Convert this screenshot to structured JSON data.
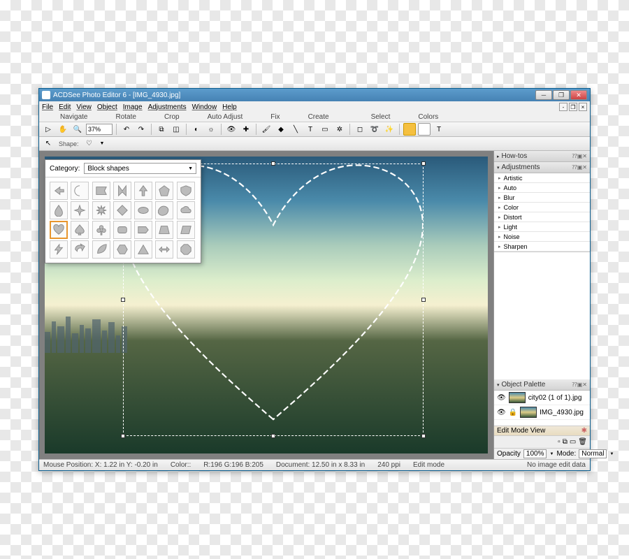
{
  "titlebar": {
    "app": "ACDSee Photo Editor 6",
    "doc": "[IMG_4930.jpg]"
  },
  "menus": [
    "File",
    "Edit",
    "View",
    "Object",
    "Image",
    "Adjustments",
    "Window",
    "Help"
  ],
  "toolgroups": {
    "navigate": "Navigate",
    "rotate": "Rotate",
    "crop": "Crop",
    "autoadj": "Auto Adjust",
    "fix": "Fix",
    "create": "Create",
    "select": "Select",
    "colors": "Colors"
  },
  "zoom": "37%",
  "shapebar": {
    "label": "Shape:"
  },
  "shape_popup": {
    "category_label": "Category:",
    "category_value": "Block shapes"
  },
  "panels": {
    "howtos": "How-tos",
    "adjustments": "Adjustments",
    "adjust_items": [
      "Artistic",
      "Auto",
      "Blur",
      "Color",
      "Distort",
      "Light",
      "Noise",
      "Sharpen"
    ],
    "object_palette": "Object Palette",
    "objects": [
      {
        "name": "city02 (1 of 1).jpg"
      },
      {
        "name": "IMG_4930.jpg"
      }
    ],
    "edit_mode": "Edit Mode View",
    "opacity_label": "Opacity",
    "opacity_value": "100%",
    "mode_label": "Mode:",
    "mode_value": "Normal"
  },
  "statusbar": {
    "mouse": "Mouse Position: X: 1.22 in   Y: -0.20 in",
    "color": "Color::",
    "rgb": "R:196  G:196  B:205",
    "document": "Document: 12.50 in x 8.33 in",
    "ppi": "240 ppi",
    "mode": "Edit mode",
    "noedit": "No image edit data"
  }
}
